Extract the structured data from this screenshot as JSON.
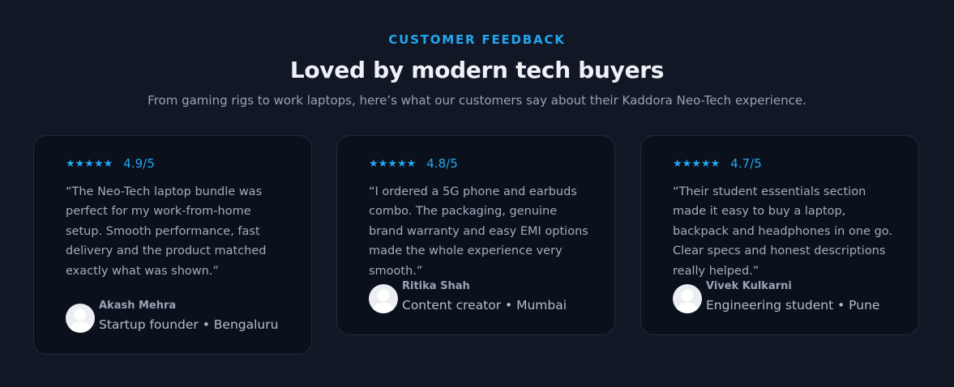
{
  "header": {
    "eyebrow": "CUSTOMER FEEDBACK",
    "title": "Loved by modern tech buyers",
    "subtitle": "From gaming rigs to work laptops, here’s what our customers say about their Kaddora Neo-Tech experience."
  },
  "colors": {
    "accent": "#22a7f0",
    "background": "#121726",
    "card": "#0b101d"
  },
  "testimonials": [
    {
      "stars": "★★★★★",
      "rating": "4.9/5",
      "quote": "“The Neo-Tech laptop bundle was perfect for my work-from-home setup. Smooth performance, fast delivery and the product matched exactly what was shown.”",
      "name": "Akash Mehra",
      "role": "Startup founder • Bengaluru",
      "avatar_icon": "user-avatar-icon"
    },
    {
      "stars": "★★★★★",
      "rating": "4.8/5",
      "quote": "“I ordered a 5G phone and earbuds combo. The packaging, genuine brand warranty and easy EMI options made the whole experience very smooth.”",
      "name": "Ritika Shah",
      "role": "Content creator • Mumbai",
      "avatar_icon": "user-avatar-icon"
    },
    {
      "stars": "★★★★★",
      "rating": "4.7/5",
      "quote": "“Their student essentials section made it easy to buy a laptop, backpack and headphones in one go. Clear specs and honest descriptions really helped.”",
      "name": "Vivek Kulkarni",
      "role": "Engineering student • Pune",
      "avatar_icon": "user-avatar-icon"
    }
  ]
}
